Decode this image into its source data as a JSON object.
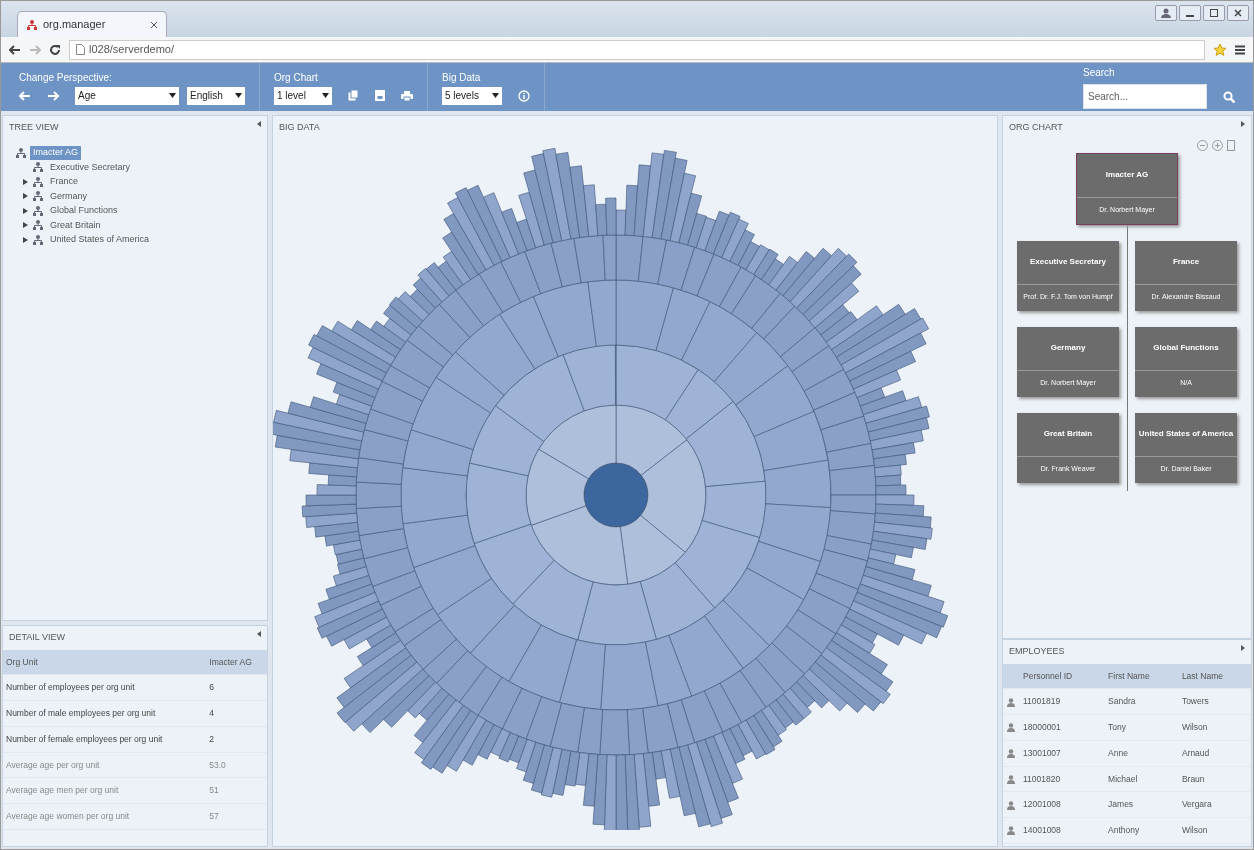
{
  "browser": {
    "tab_title": "org.manager",
    "url": "l028/serverdemo/"
  },
  "toolbar": {
    "perspective": {
      "label": "Change Perspective:",
      "select": "Age",
      "language": "English"
    },
    "org_chart": {
      "label": "Org Chart",
      "select": "1 level"
    },
    "big_data": {
      "label": "Big Data",
      "select": "5 levels"
    },
    "search": {
      "label": "Search",
      "placeholder": "Search..."
    }
  },
  "tree_view": {
    "title": "TREE VIEW",
    "items": [
      {
        "label": "Imacter AG",
        "selected": true,
        "children": [
          {
            "label": "Executive Secretary",
            "selected": false
          },
          {
            "label": "France",
            "selected": false,
            "expanded": false
          },
          {
            "label": "Germany",
            "selected": false,
            "expanded": false
          },
          {
            "label": "Global Functions",
            "selected": false,
            "expanded": false
          },
          {
            "label": "Great Britain",
            "selected": false,
            "expanded": false
          },
          {
            "label": "United States of America",
            "selected": false,
            "expanded": false
          }
        ]
      }
    ]
  },
  "detail_view": {
    "title": "DETAIL VIEW",
    "header": [
      "Org Unit",
      "Imacter AG"
    ],
    "rows": [
      [
        "Number of employees per org unit",
        "6"
      ],
      [
        "Number of male employees per org unit",
        "4"
      ],
      [
        "Number of female employees per org unit",
        "2"
      ],
      [
        "Average age per org unit",
        "53.0"
      ],
      [
        "Average age men per org unit",
        "51"
      ],
      [
        "Average age women per org unit",
        "57"
      ]
    ]
  },
  "big_data": {
    "title": "BIG DATA"
  },
  "org_chart": {
    "title": "ORG CHART",
    "root": {
      "name": "Imacter AG",
      "head": "Dr. Norbert Mayer",
      "selected": true
    },
    "units": [
      {
        "name": "Executive Secretary",
        "head": "Prof. Dr. F.J. Tom von Humpf",
        "selected": false
      },
      {
        "name": "France",
        "head": "Dr. Alexandre Bissaud",
        "selected": false
      },
      {
        "name": "Germany",
        "head": "Dr. Norbert Mayer",
        "selected": false
      },
      {
        "name": "Global Functions",
        "head": "N/A",
        "selected": false
      },
      {
        "name": "Great Britain",
        "head": "Dr. Frank Weaver",
        "selected": false
      },
      {
        "name": "United States of America",
        "head": "Dr. Daniel Baker",
        "selected": false
      }
    ]
  },
  "employees": {
    "title": "EMPLOYEES",
    "columns": [
      "Personnel ID",
      "First Name",
      "Last Name"
    ],
    "rows": [
      [
        "11001819",
        "Sandra",
        "Towers"
      ],
      [
        "18000001",
        "Tony",
        "Wilson"
      ],
      [
        "13001007",
        "Anne",
        "Arnaud"
      ],
      [
        "11001820",
        "Michael",
        "Braun"
      ],
      [
        "12001008",
        "James",
        "Vergara"
      ],
      [
        "14001008",
        "Anthony",
        "Wilson"
      ]
    ]
  }
}
